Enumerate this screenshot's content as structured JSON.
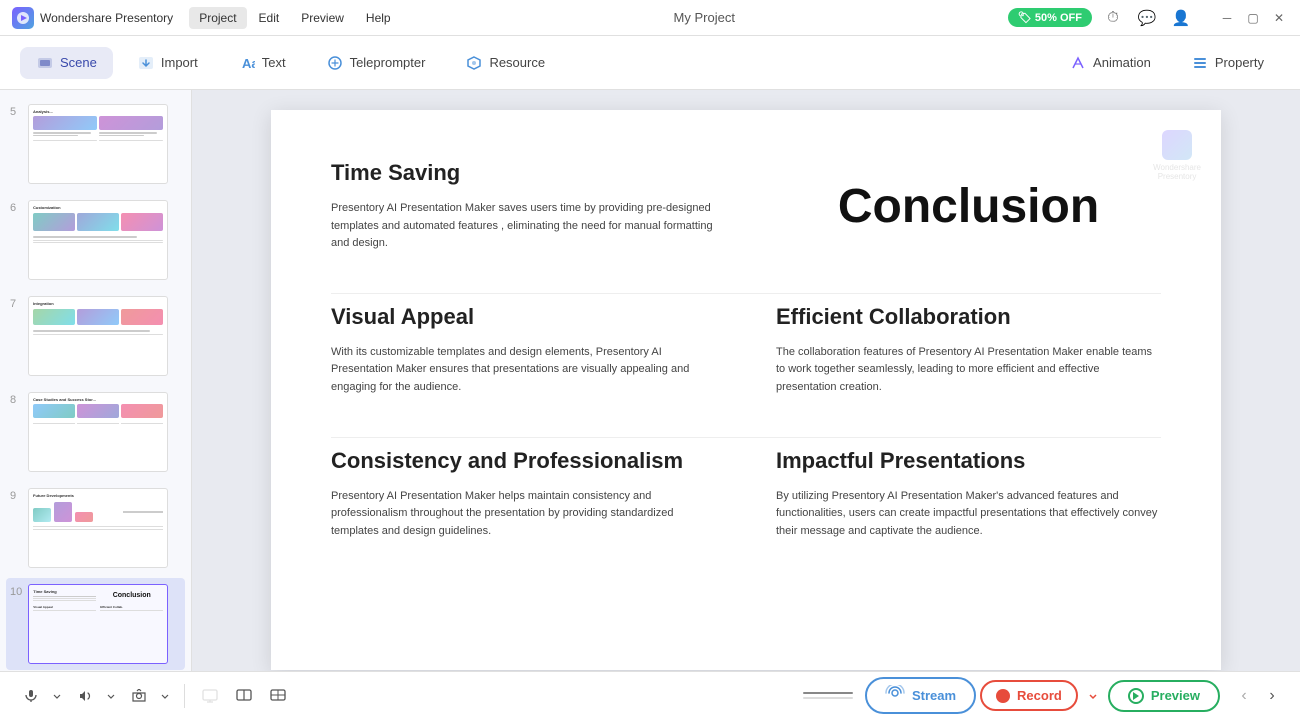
{
  "app": {
    "name": "Wondershare Presentory",
    "logo_text": "W",
    "project_title": "My Project",
    "promo": "50% OFF"
  },
  "menu": {
    "items": [
      "Project",
      "Edit",
      "Preview",
      "Help"
    ],
    "active": "Project"
  },
  "toolbar": {
    "scene_label": "Scene",
    "import_label": "Import",
    "text_label": "Text",
    "teleprompter_label": "Teleprompter",
    "resource_label": "Resource",
    "animation_label": "Animation",
    "property_label": "Property"
  },
  "slides": [
    {
      "number": "5",
      "title": "Analysis...",
      "type": "multi"
    },
    {
      "number": "6",
      "title": "Customization",
      "type": "multi"
    },
    {
      "number": "7",
      "title": "Integration",
      "type": "multi"
    },
    {
      "number": "8",
      "title": "Case Studies and Success Stories",
      "type": "multi"
    },
    {
      "number": "9",
      "title": "Future Developments",
      "type": "multi"
    },
    {
      "number": "10",
      "title": "Time Saving",
      "type": "conclusion",
      "active": true
    }
  ],
  "canvas": {
    "watermark": {
      "text": "Wondershare\nPresentory"
    },
    "sections": [
      {
        "id": "time-saving",
        "title": "Time Saving",
        "text": "Presentory AI Presentation Maker saves users time by providing pre-designed templates and automated features , eliminating the need for manual formatting and design.",
        "col": 1,
        "row": 1
      },
      {
        "id": "conclusion",
        "title": "Conclusion",
        "text": "",
        "col": 2,
        "row": 1,
        "is_heading": true
      },
      {
        "id": "visual-appeal",
        "title": "Visual Appeal",
        "text": "With its customizable templates and design elements, Presentory AI Presentation Maker ensures that presentations are visually appealing and engaging for the audience.",
        "col": 1,
        "row": 2
      },
      {
        "id": "efficient-collab",
        "title": "Efficient Collaboration",
        "text": "The collaboration features of Presentory AI Presentation Maker enable teams to work together seamlessly, leading to more efficient and effective presentation creation.",
        "col": 2,
        "row": 2
      },
      {
        "id": "consistency",
        "title": "Consistency and Professionalism",
        "text": "Presentory AI Presentation Maker helps maintain consistency and professionalism throughout the presentation by providing standardized templates and design guidelines.",
        "col": 1,
        "row": 3
      },
      {
        "id": "impactful",
        "title": "Impactful Presentations",
        "text": "By utilizing Presentory AI Presentation Maker's advanced features and functionalities, users can create impactful presentations that effectively convey their message and captivate the audience.",
        "col": 2,
        "row": 3
      }
    ]
  },
  "bottom_bar": {
    "stream_label": "Stream",
    "record_label": "Record",
    "preview_label": "Preview"
  },
  "colors": {
    "accent_blue": "#4a90d9",
    "accent_red": "#e74c3c",
    "accent_green": "#27ae60",
    "accent_purple": "#7b61ff",
    "promo_green": "#2ecc71"
  }
}
